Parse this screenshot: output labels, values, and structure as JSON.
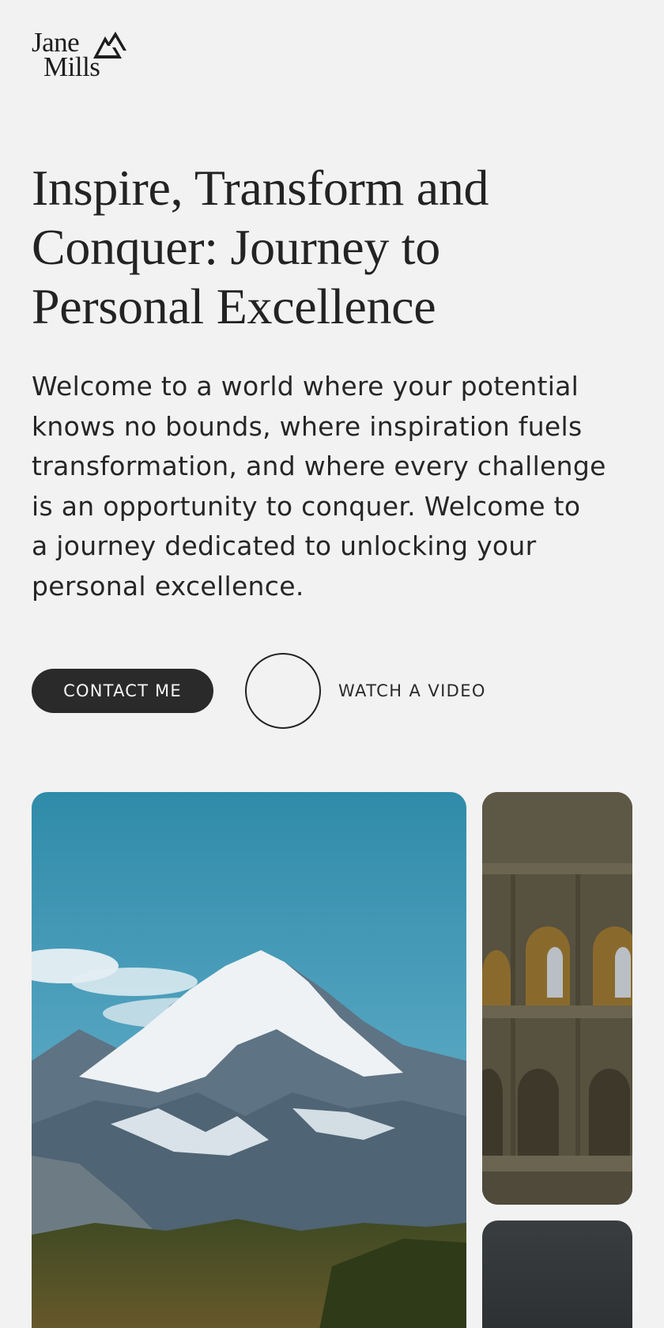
{
  "brand": {
    "name_line1": "Jane",
    "name_line2": "Mills",
    "logo_icon": "mountain-peaks-icon"
  },
  "hero": {
    "headline_lines": [
      "Inspire, Transform and",
      "Conquer: Journey to",
      "Personal Excellence"
    ],
    "intro_lines": [
      "Welcome to a world where your potential",
      "knows no bounds, where inspiration fuels",
      "transformation, and where every challenge",
      "is an opportunity to conquer. Welcome to",
      "a journey dedicated to unlocking your",
      "personal excellence."
    ]
  },
  "actions": {
    "contact_label": "CONTACT ME",
    "watch_label": "WATCH A VIDEO",
    "play_icon": "play-circle-icon"
  },
  "gallery": {
    "images": [
      {
        "subject": "snow-capped mountain under blue sky"
      },
      {
        "subject": "ancient colosseum arches"
      },
      {
        "subject": "dark gradient photo"
      }
    ]
  },
  "colors": {
    "background": "#f2f2f2",
    "text": "#252525",
    "button_bg": "#2a2a2a",
    "button_text": "#f5f5f5"
  }
}
